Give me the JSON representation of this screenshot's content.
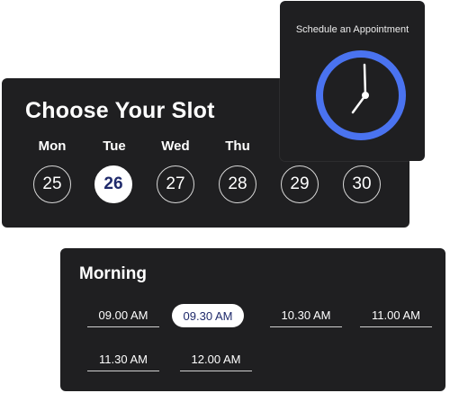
{
  "slot_card": {
    "title": "Choose Your Slot",
    "days": [
      {
        "label": "Mon",
        "date": "25",
        "selected": false
      },
      {
        "label": "Tue",
        "date": "26",
        "selected": true
      },
      {
        "label": "Wed",
        "date": "27",
        "selected": false
      },
      {
        "label": "Thu",
        "date": "28",
        "selected": false
      },
      {
        "label": "",
        "date": "29",
        "selected": false
      },
      {
        "label": "",
        "date": "30",
        "selected": false
      }
    ]
  },
  "clock_card": {
    "title": "Schedule an Appointment",
    "icon": "clock-icon",
    "ring_color": "#4a73f0"
  },
  "morning_card": {
    "title": "Morning",
    "times": [
      {
        "label": "09.00 AM",
        "selected": false
      },
      {
        "label": "09.30 AM",
        "selected": true
      },
      {
        "label": "10.30 AM",
        "selected": false
      },
      {
        "label": "11.00 AM",
        "selected": false
      },
      {
        "label": "11.30 AM",
        "selected": false
      },
      {
        "label": "12.00 AM",
        "selected": false
      }
    ]
  },
  "colors": {
    "card_bg": "#1f1f21",
    "accent_text": "#1f2a6b",
    "accent_ring": "#4a73f0"
  }
}
